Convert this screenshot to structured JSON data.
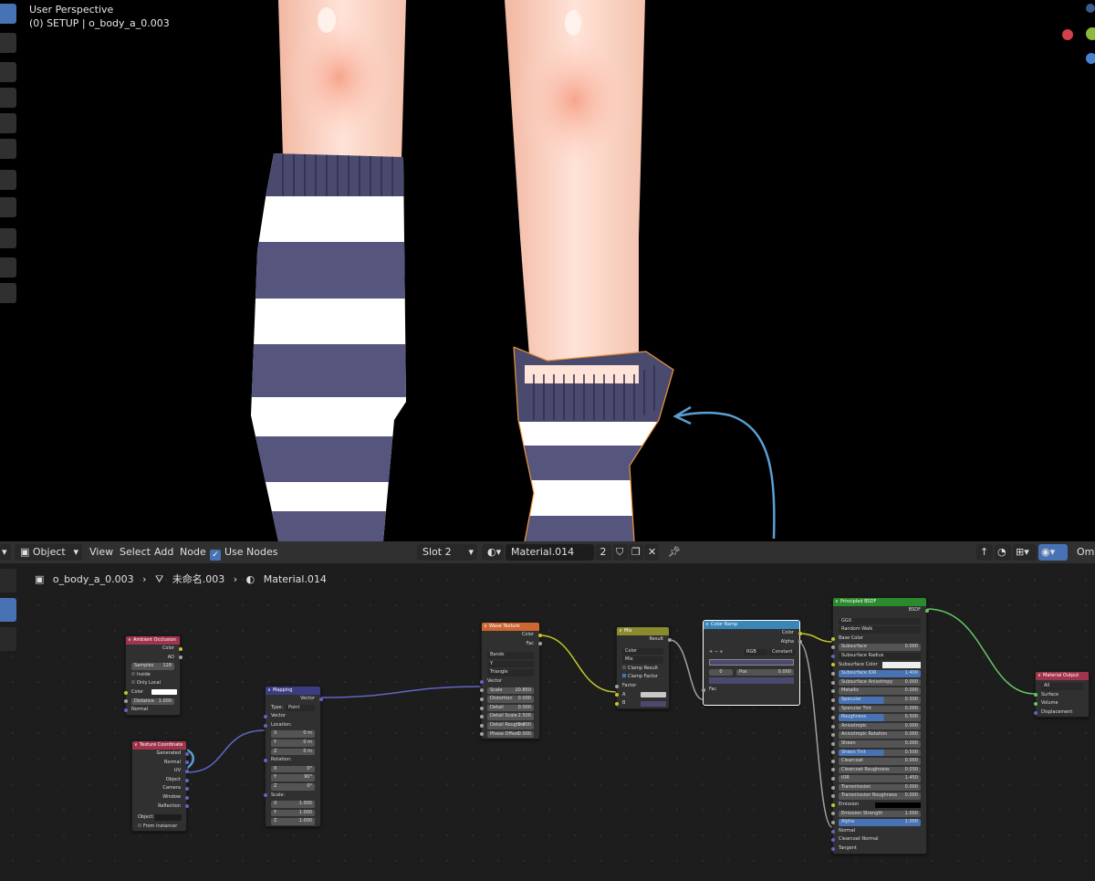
{
  "viewport": {
    "title": "User Perspective",
    "subtitle": "(0) SETUP | o_body_a_0.003"
  },
  "header": {
    "mode": "Object",
    "menus": [
      "View",
      "Select",
      "Add",
      "Node"
    ],
    "use_nodes_label": "Use Nodes",
    "slot": "Slot 2",
    "material": "Material.014",
    "users": "2",
    "right_label": "Omn"
  },
  "breadcrumb": {
    "object": "o_body_a_0.003",
    "mesh": "未命名.003",
    "material": "Material.014"
  },
  "colors": {
    "ao_header": "#a1344c",
    "texcoord_header": "#a1344c",
    "mapping_header": "#3c3c83",
    "wave_header": "#cc6633",
    "mix_header": "#8a8a2e",
    "ramp_header": "#3a86b8",
    "bsdf_header": "#2b8a2b",
    "output_header": "#a1344c",
    "sock_color": "#c7c729",
    "sock_float": "#a1a1a1",
    "sock_vector": "#6363c7",
    "sock_shader": "#63c763",
    "link_vector": "#6363c7",
    "link_color": "#c7c729",
    "link_shader": "#63c763",
    "annotation": "#5a9fd4"
  },
  "nodes": {
    "ao": {
      "title": "Ambient Occlusion",
      "out_color": "Color",
      "out_ao": "AO",
      "samples_label": "Samples",
      "samples_value": "128",
      "inside": "Inside",
      "only_local": "Only Local",
      "in_color": "Color",
      "in_distance": "Distance",
      "distance_value": "1.000",
      "in_normal": "Normal"
    },
    "texcoord": {
      "title": "Texture Coordinate",
      "outs": [
        "Generated",
        "Normal",
        "UV",
        "Object",
        "Camera",
        "Window",
        "Reflection"
      ],
      "object_label": "Object:",
      "from_instancer": "From Instancer"
    },
    "mapping": {
      "title": "Mapping",
      "out_vector": "Vector",
      "type_label": "Type:",
      "type_value": "Point",
      "in_vector": "Vector",
      "location": "Location:",
      "loc": [
        [
          "X",
          "0 m"
        ],
        [
          "Y",
          "0 m"
        ],
        [
          "Z",
          "0 m"
        ]
      ],
      "rotation": "Rotation:",
      "rot": [
        [
          "X",
          "0°"
        ],
        [
          "Y",
          "90°"
        ],
        [
          "Z",
          "0°"
        ]
      ],
      "scale": "Scale:",
      "scl": [
        [
          "X",
          "1.000"
        ],
        [
          "Y",
          "1.000"
        ],
        [
          "Z",
          "1.000"
        ]
      ]
    },
    "wave": {
      "title": "Wave Texture",
      "out_color": "Color",
      "out_fac": "Fac",
      "type": "Bands",
      "dir": "Y",
      "profile": "Triangle",
      "in_vector": "Vector",
      "fields": [
        [
          "Scale",
          "20.850"
        ],
        [
          "Distortion",
          "0.000"
        ],
        [
          "Detail",
          "0.000"
        ],
        [
          "Detail Scale",
          "2.500"
        ],
        [
          "Detail Roughne",
          "0.000"
        ],
        [
          "Phase Offset",
          "0.000"
        ]
      ]
    },
    "mix": {
      "title": "Mix",
      "out_result": "Result",
      "dtype": "Color",
      "blend": "Mix",
      "clamp_result": "Clamp Result",
      "clamp_factor": "Clamp Factor",
      "in_factor": "Factor",
      "in_a": "A",
      "in_b": "B"
    },
    "ramp": {
      "title": "Color Ramp",
      "out_color": "Color",
      "out_alpha": "Alpha",
      "mode": "RGB",
      "interp": "Constant",
      "stop_index": "0",
      "pos_label": "Pos",
      "pos_value": "0.000",
      "in_fac": "Fac"
    },
    "bsdf": {
      "title": "Principled BSDF",
      "out_bsdf": "BSDF",
      "dist": "GGX",
      "sss": "Random Walk",
      "in_base_color": "Base Color",
      "fields": [
        [
          "Subsurface",
          "0.000",
          ""
        ],
        [
          "Subsurface Radius",
          "",
          "dd"
        ],
        [
          "Subsurface Color",
          "",
          "color"
        ],
        [
          "Subsurface IOR",
          "1.400",
          "blue"
        ],
        [
          "Subsurface Anisotropy",
          "0.000",
          ""
        ],
        [
          "Metallic",
          "0.000",
          ""
        ],
        [
          "Specular",
          "0.500",
          "pbar"
        ],
        [
          "Specular Tint",
          "0.000",
          ""
        ],
        [
          "Roughness",
          "0.500",
          "pbar"
        ],
        [
          "Anisotropic",
          "0.000",
          ""
        ],
        [
          "Anisotropic Rotation",
          "0.000",
          ""
        ],
        [
          "Sheen",
          "0.000",
          ""
        ],
        [
          "Sheen Tint",
          "0.500",
          "pbar"
        ],
        [
          "Clearcoat",
          "0.000",
          ""
        ],
        [
          "Clearcoat Roughness",
          "0.030",
          ""
        ],
        [
          "IOR",
          "1.450",
          ""
        ],
        [
          "Transmission",
          "0.000",
          ""
        ],
        [
          "Transmission Roughness",
          "0.000",
          ""
        ]
      ],
      "emission": "Emission",
      "emission_strength": "Emission Strength",
      "emission_strength_value": "1.000",
      "alpha": "Alpha",
      "alpha_value": "1.000",
      "in_normal": "Normal",
      "in_clearcoat_normal": "Clearcoat Normal",
      "in_tangent": "Tangent"
    },
    "output": {
      "title": "Material Output",
      "target": "All",
      "in_surface": "Surface",
      "in_volume": "Volume",
      "in_displacement": "Displacement"
    }
  }
}
